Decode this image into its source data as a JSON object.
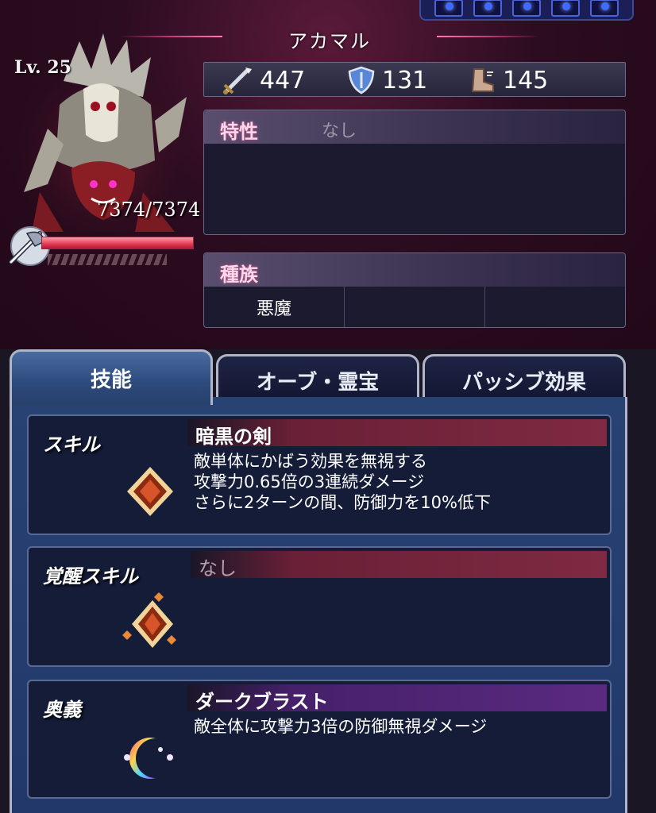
{
  "character": {
    "name": "アカマル",
    "level": "Lv. 25",
    "hp_text": "7374/7374",
    "hp_fraction": 1.0
  },
  "stats": {
    "attack": {
      "icon": "sword-icon",
      "value": "447"
    },
    "defense": {
      "icon": "shield-icon",
      "value": "131"
    },
    "speed": {
      "icon": "boot-icon",
      "value": "145"
    }
  },
  "traits": {
    "title": "特性",
    "value": "なし"
  },
  "race": {
    "title": "種族",
    "values": [
      "悪魔",
      "",
      ""
    ]
  },
  "tabs": [
    {
      "label": "技能",
      "active": true
    },
    {
      "label": "オーブ・霊宝",
      "active": false
    },
    {
      "label": "パッシブ効果",
      "active": false
    }
  ],
  "skills": [
    {
      "label": "スキル",
      "name": "暗黒の剣",
      "description": "敵単体にかばう効果を無視する\n攻撃力0.65倍の3連続ダメージ\nさらに2ターンの間、防御力を10%低下",
      "icon": "skill-crystal-icon"
    },
    {
      "label": "覚醒スキル",
      "name": "なし",
      "description": "",
      "icon": "awakened-skill-crystal-icon"
    },
    {
      "label": "奥義",
      "name": "ダークブラスト",
      "description": "敵全体に攻撃力3倍の防御無視ダメージ",
      "icon": "ultimate-moon-icon"
    }
  ],
  "colors": {
    "hp_bar": "#e23a55",
    "skill_bar": "#7e2a42",
    "ultimate_bar": "#5a2a80",
    "tab_active": "#2c4a7c"
  }
}
